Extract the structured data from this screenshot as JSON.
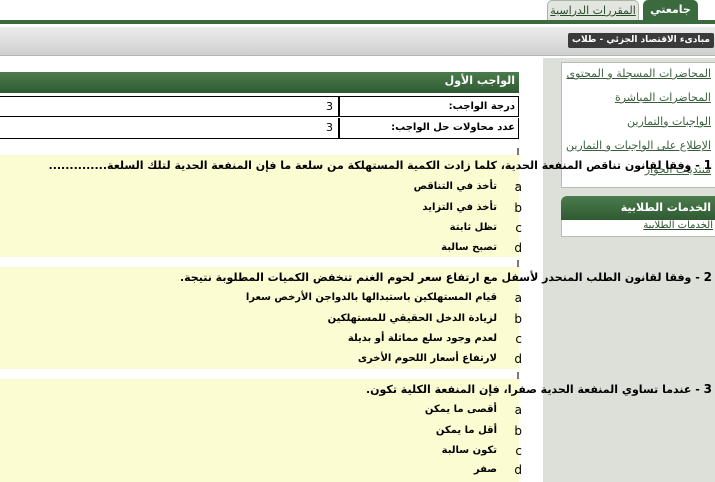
{
  "tabs": {
    "home": "جامعتي",
    "courses": "المقررات الدراسية"
  },
  "breadcrumb": "مبادىء الاقتصاد الجزئي - طلاب",
  "sidebar": {
    "items": [
      {
        "label": "المحاضرات المسجلة و المحتوى"
      },
      {
        "label": "المحاضرات المباشرة"
      },
      {
        "label": "الواجبات والتمارين"
      },
      {
        "label": "الإطلاع على الواجبات و التمارين"
      },
      {
        "label": "منتديات الحوار"
      }
    ],
    "services_header": "الخدمات الطلابية",
    "services_link": "الخدمات الطلابية"
  },
  "assignment": {
    "title": "الواجب الأول",
    "grade_label": "درجة الواجب:",
    "grade_value": "3",
    "attempts_label": "عدد محاولات حل الواجب:",
    "attempts_value": "3"
  },
  "questions": [
    {
      "num": "1",
      "text": "- وفقا لقانون تناقص المنفعة الحدية، كلما زادت الكمية المستهلكة من سلعة ما فإن المنفعة الحدية لتلك السلعة..............",
      "options": [
        {
          "letter": "a",
          "text": "تأخذ في التناقص"
        },
        {
          "letter": "b",
          "text": "تأخذ في التزايد"
        },
        {
          "letter": "c",
          "text": "تظل ثابتة"
        },
        {
          "letter": "d",
          "text": "تصبح سالبة"
        }
      ]
    },
    {
      "num": "2",
      "text": "- وفقا لقانون الطلب المنحدر لأسفل مع ارتفاع سعر لحوم الغنم تنخفض الكميات المطلوبة نتيجة.",
      "options": [
        {
          "letter": "a",
          "text": "قيام المستهلكين باستبدالها بالدواجن الأرخص سعرا"
        },
        {
          "letter": "b",
          "text": "لزيادة الدخل الحقيقي للمستهلكين"
        },
        {
          "letter": "c",
          "text": "لعدم وجود سلع مماثلة أو بديلة"
        },
        {
          "letter": "d",
          "text": "لارتفاع أسعار اللحوم الأخرى"
        }
      ]
    },
    {
      "num": "3",
      "text": "- عندما تساوي المنفعة الحدية صفرا، فإن المنفعة الكلية تكون.",
      "options": [
        {
          "letter": "a",
          "text": "أقصى ما يمكن"
        },
        {
          "letter": "b",
          "text": "أقل ما يمكن"
        },
        {
          "letter": "c",
          "text": "تكون سالبة"
        },
        {
          "letter": "d",
          "text": "صفر"
        }
      ]
    }
  ]
}
